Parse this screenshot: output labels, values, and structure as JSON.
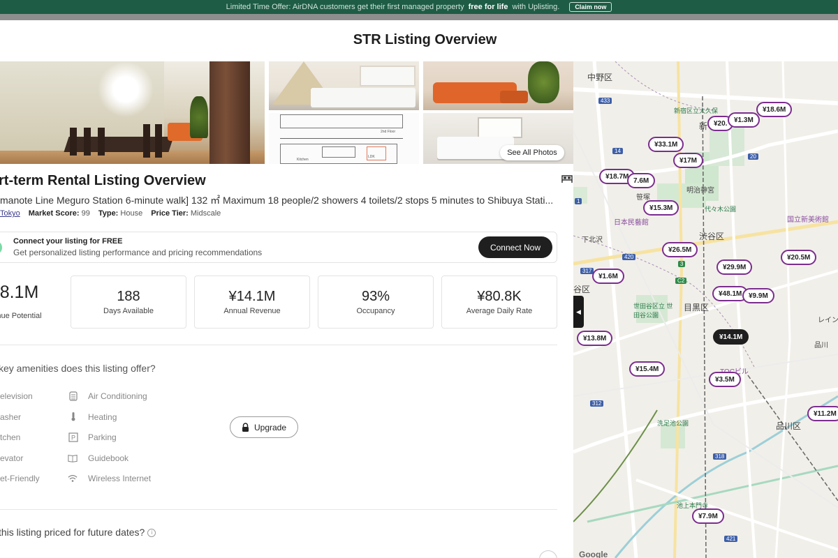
{
  "promo": {
    "text": "Limited Time Offer: AirDNA customers get their first managed property",
    "bold": "free for life",
    "suffix": "with Uplisting.",
    "claim_label": "Claim now"
  },
  "page": {
    "title": "STR Listing Overview"
  },
  "photos": {
    "see_all_label": "See All Photos",
    "plan_label_1": "2nd Floor",
    "plan_label_2": "Kitchen",
    "plan_label_3": "LDK"
  },
  "listing": {
    "title": "rt-term Rental Listing Overview",
    "subtitle": "manote Line Meguro Station 6-minute walk] 132 ㎡ Maximum 18 people/2 showers 4 toilets/2 stops 5 minutes to Shibuya Stati...",
    "location_link": "Tokyo",
    "market_score_label": "Market Score:",
    "market_score": "99",
    "type_label": "Type:",
    "type_value": "House",
    "price_tier_label": "Price Tier:",
    "price_tier_value": "Midscale"
  },
  "connect": {
    "heading": "Connect your listing for FREE",
    "text": "Get personalized listing performance and pricing recommendations",
    "button_label": "Connect Now"
  },
  "metrics": [
    {
      "value": "8.1M",
      "label": "nue Potential"
    },
    {
      "value": "188",
      "label": "Days Available"
    },
    {
      "value": "¥14.1M",
      "label": "Annual Revenue"
    },
    {
      "value": "93%",
      "label": "Occupancy"
    },
    {
      "value": "¥80.8K",
      "label": "Average Daily Rate"
    }
  ],
  "amenities": {
    "question": "key amenities does this listing offer?",
    "left": [
      "elevision",
      "asher",
      "tchen",
      "evator",
      "et-Friendly"
    ],
    "right": [
      "Air Conditioning",
      "Heating",
      "Parking",
      "Guidebook",
      "Wireless Internet"
    ],
    "upgrade_label": "Upgrade"
  },
  "pricing": {
    "question": " this listing priced for future dates?"
  },
  "map": {
    "pins": [
      "¥18.6M",
      "¥20.",
      "¥1.3M",
      "¥33.1M",
      "¥17M",
      "¥18.7M",
      "7.6M",
      "¥15.3M",
      "¥26.5M",
      "¥20.5M",
      "¥1.6M",
      "¥29.9M",
      "¥48.1M",
      "¥9.9M",
      "¥14.1M",
      "¥13.8M",
      "¥15.4M",
      "¥3.5M",
      "¥11.2M",
      "¥7.9M"
    ],
    "labels": [
      "中野区",
      "新宿区",
      "明治神宮",
      "渋谷区",
      "目黒区",
      "世田谷区立 世田谷公園",
      "品川区",
      "洗足池公園",
      "日本民藝館",
      "国立新美術館",
      "下北沢",
      "笹塚",
      "代々木公園",
      "TOCビル",
      "池上本門寺",
      "谷区",
      "レインボ",
      "品川",
      "新宿区立大久保",
      "新"
    ],
    "route_numbers": [
      "433",
      "14",
      "20",
      "317",
      "420",
      "3",
      "C2",
      "312",
      "318",
      "421",
      "1"
    ],
    "google_label": "Google"
  },
  "colors": {
    "promo_bg": "#1e5c45",
    "pin_border": "#7b2d8e",
    "dark_button": "#1f1f1f"
  }
}
